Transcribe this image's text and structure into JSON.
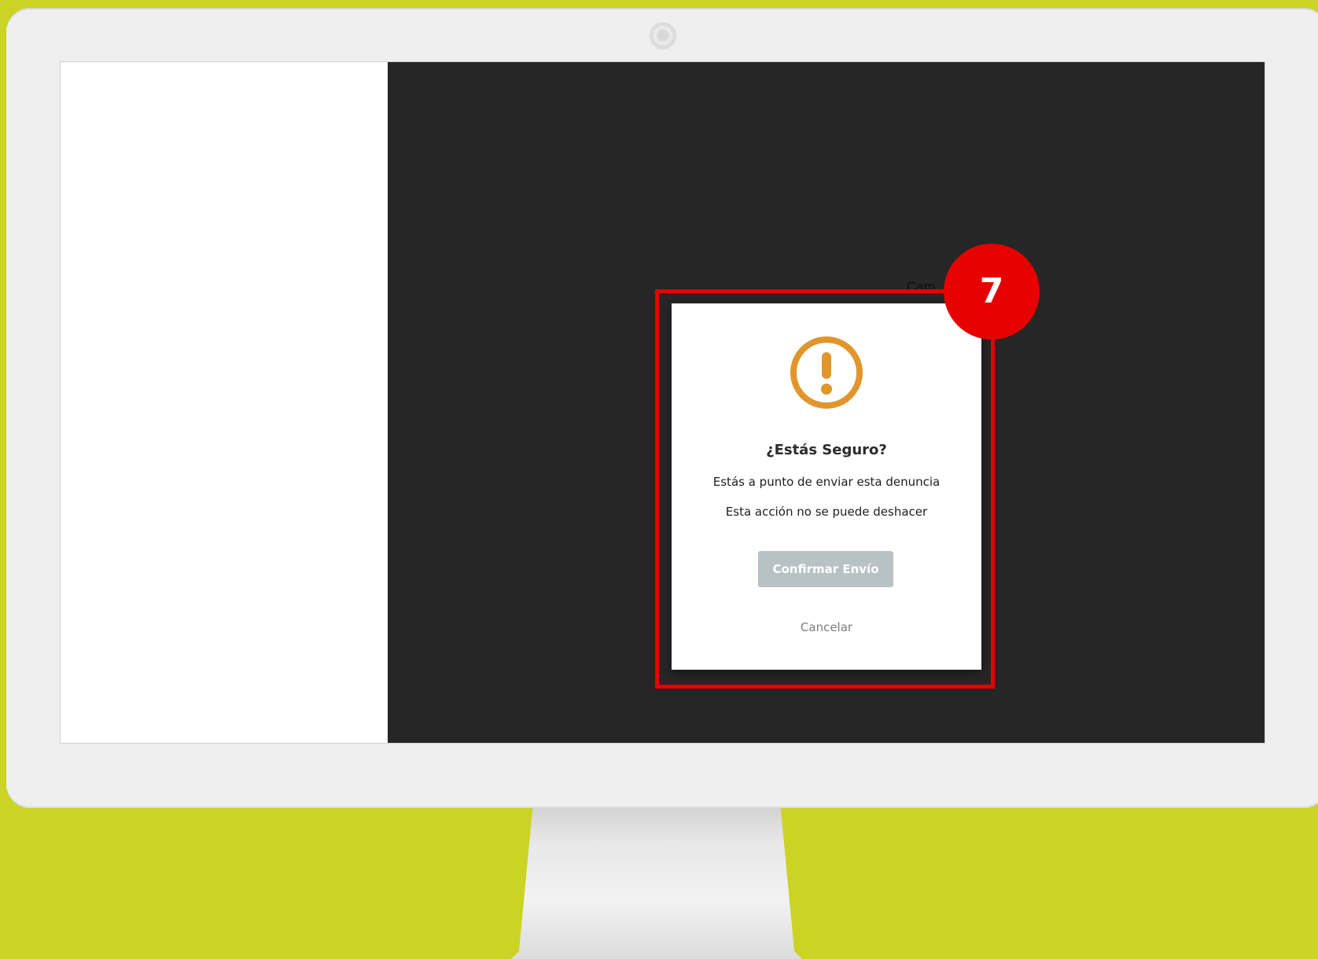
{
  "screen": {
    "hidden_label": "Cam"
  },
  "dialog": {
    "icon": "exclamation-circle-icon",
    "icon_color": "#e0962c",
    "title": "¿Estás Seguro?",
    "message_line1": "Estás a punto de enviar esta denuncia",
    "message_line2": "Esta acción no se puede deshacer",
    "confirm_label": "Confirmar Envío",
    "cancel_label": "Cancelar"
  },
  "annotation": {
    "step_number": "7",
    "color": "#e60000"
  },
  "colors": {
    "background": "#cbd324",
    "overlay": "#262626",
    "button_disabled": "#b7c2c5"
  }
}
